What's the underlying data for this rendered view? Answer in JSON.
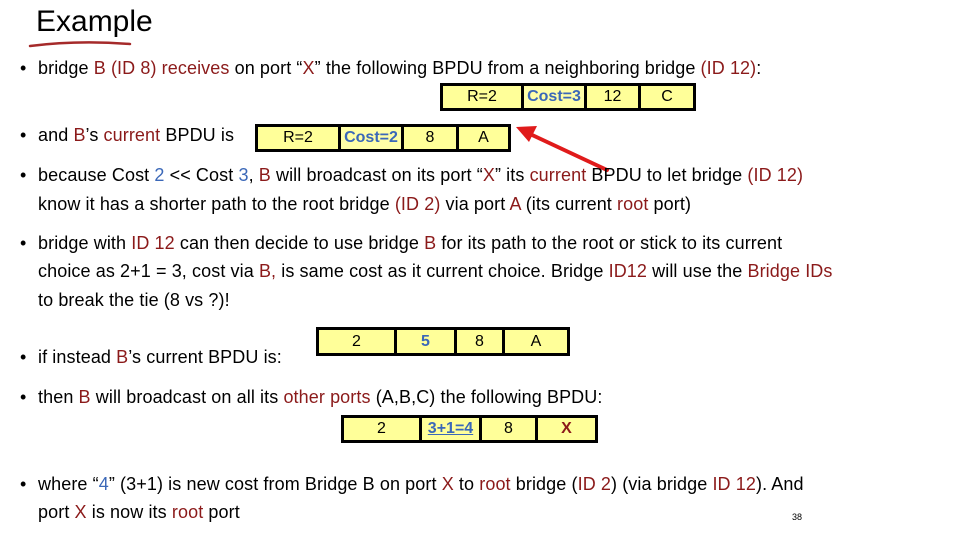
{
  "slide": {
    "title": "Example",
    "page_number": "38",
    "colors": {
      "red": "#8b1a1a",
      "blue": "#3b68b8",
      "bpdu_fill": "#ffff99",
      "arrow": "#e01b1b"
    }
  },
  "bullets": {
    "b1": {
      "bullet": "•",
      "p1": "bridge ",
      "r1": "B (ID 8) receives",
      "p2": " on port “",
      "r2": "X",
      "p3": "” the following BPDU from a neighboring bridge ",
      "r3": "(ID 12)",
      "p4": ":"
    },
    "b2": {
      "bullet": "•",
      "p1": "and ",
      "r1": "B",
      "p2": "’s ",
      "r2": "current",
      "p3": " BPDU is"
    },
    "b3": {
      "bullet": "•",
      "l1_p1": "because Cost ",
      "l1_b1": "2",
      "l1_p2": " << Cost ",
      "l1_b2": "3",
      "l1_p3": ", ",
      "l1_r1": "B",
      "l1_p4": " will broadcast on its port “",
      "l1_r2": "X",
      "l1_p5": "” its ",
      "l1_r3": "current",
      "l1_p6": " BPDU to let bridge ",
      "l1_r4": "(ID 12)",
      "l2_p1": "know it has a shorter path to the root bridge ",
      "l2_r1": "(ID 2)",
      "l2_p2": " via port ",
      "l2_r2": "A",
      "l2_p3": " (its current ",
      "l2_r3": "root",
      "l2_p4": " port)"
    },
    "b4": {
      "bullet": "•",
      "l1_p1": "bridge with ",
      "l1_r1": "ID 12",
      "l1_p2": " can then decide to use bridge ",
      "l1_r2": "B",
      "l1_p3": " for its path to the root or stick to its current",
      "l2_p1": "choice as 2+1 = 3, cost via ",
      "l2_r1": "B,",
      "l2_p2": " is same cost as it current choice. Bridge ",
      "l2_r2": "ID12",
      "l2_p3": " will use the ",
      "l2_r3": "Bridge IDs",
      "l3": "to break the tie (8 vs ?)!"
    },
    "b5": {
      "bullet": "•",
      "p1": "if instead ",
      "r1": "B",
      "p2": "’s current BPDU is:"
    },
    "b6": {
      "bullet": "•",
      "p1": "then ",
      "r1": "B",
      "p2": " will broadcast on all its ",
      "r2": "other ports",
      "p3": " (A,B,C) the following BPDU:"
    },
    "b7": {
      "bullet": "•",
      "l1_p1": "where “",
      "l1_b1": "4",
      "l1_p2": "” (3+1) is new cost from Bridge B on port ",
      "l1_r1": "X",
      "l1_p3": " to ",
      "l1_r2": "root",
      "l1_p4": " bridge (",
      "l1_r3": "ID 2",
      "l1_p5": ") (via bridge ",
      "l1_r4": "ID 12",
      "l1_p6": "). And",
      "l2_p1": "port ",
      "l2_r1": "X",
      "l2_p2": " is now its ",
      "l2_r2": "root",
      "l2_p3": " port"
    }
  },
  "bpdus": {
    "received": [
      "R=2",
      "Cost=3",
      "12",
      "C"
    ],
    "current": [
      "R=2",
      "Cost=2",
      "8",
      "A"
    ],
    "alt_current": [
      "2",
      "5",
      "8",
      "A"
    ],
    "broadcast": [
      "2",
      "3+1=4",
      "8",
      "X"
    ]
  }
}
